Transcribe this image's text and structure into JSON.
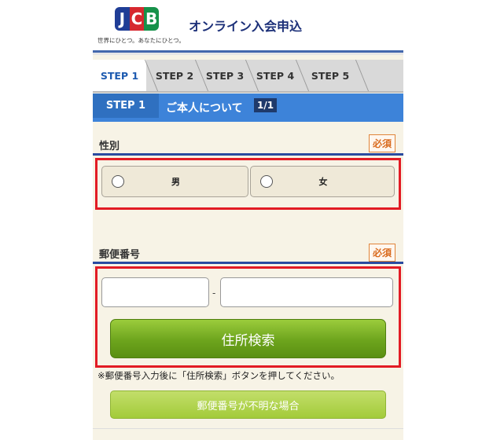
{
  "header": {
    "logo_text": "JCB",
    "tagline": "世界にひとつ。あなたにひとつ。",
    "title": "オンライン入会申込"
  },
  "steps": {
    "tabs": [
      "STEP 1",
      "STEP 2",
      "STEP 3",
      "STEP 4",
      "STEP 5"
    ],
    "active_index": 0
  },
  "banner": {
    "step": "STEP 1",
    "label": "ご本人について",
    "page": "1/1"
  },
  "gender": {
    "title": "性別",
    "required": "必須",
    "options": [
      "男",
      "女"
    ]
  },
  "postal": {
    "title": "郵便番号",
    "required": "必須",
    "separator": "-",
    "first_value": "",
    "second_value": "",
    "search_button": "住所検索",
    "note": "※郵便番号入力後に「住所検索」ボタンを押してください。",
    "unknown_button": "郵便番号が不明な場合"
  },
  "colors": {
    "header_blue": "#1b2f78",
    "banner_blue": "#3d83d9",
    "highlight_red": "#e21b24",
    "button_green": "#6da41d",
    "required_orange": "#d96b1f"
  }
}
